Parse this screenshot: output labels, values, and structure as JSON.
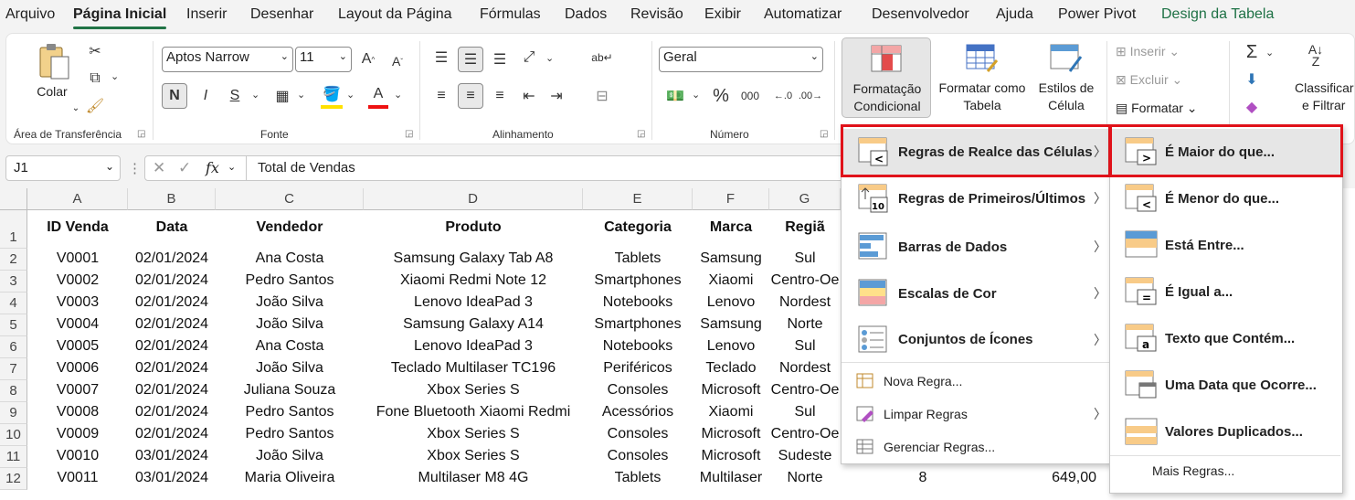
{
  "tabs": [
    "Arquivo",
    "Página Inicial",
    "Inserir",
    "Desenhar",
    "Layout da Página",
    "Fórmulas",
    "Dados",
    "Revisão",
    "Exibir",
    "Automatizar",
    "Desenvolvedor",
    "Ajuda",
    "Power Pivot",
    "Design da Tabela"
  ],
  "ribbon": {
    "clipboard": {
      "paste": "Colar",
      "group": "Área de Transferência"
    },
    "font": {
      "name": "Aptos Narrow",
      "size": "11",
      "group": "Fonte",
      "bold": "N",
      "italic": "I",
      "underline": "S"
    },
    "alignment": {
      "group": "Alinhamento"
    },
    "number": {
      "format": "Geral",
      "group": "Número",
      "percent": "%",
      "thousands": "000"
    },
    "styles": {
      "conditional": "Formatação Condicional",
      "conditional_l1": "Formatação",
      "conditional_l2": "Condicional",
      "table_l1": "Formatar como",
      "table_l2": "Tabela",
      "cell_l1": "Estilos de",
      "cell_l2": "Célula"
    },
    "cells": {
      "insert": "Inserir",
      "delete": "Excluir",
      "format": "Formatar"
    },
    "editing": {
      "sort_l1": "Classificar",
      "sort_l2": "e Filtrar"
    }
  },
  "formula_bar": {
    "cell_ref": "J1",
    "fx": "fx",
    "content": "Total de Vendas"
  },
  "columns": [
    "A",
    "B",
    "C",
    "D",
    "E",
    "F",
    "G"
  ],
  "rows": [
    "1",
    "2",
    "3",
    "4",
    "5",
    "6",
    "7",
    "8",
    "9",
    "10",
    "11",
    "12"
  ],
  "table": {
    "headers": [
      "ID Venda",
      "Data",
      "Vendedor",
      "Produto",
      "Categoria",
      "Marca",
      "Região"
    ],
    "header_shown": [
      "ID Venda",
      "Data",
      "Vendedor",
      "Produto",
      "Categoria",
      "Marca",
      "Regiã"
    ],
    "data": [
      [
        "V0001",
        "02/01/2024",
        "Ana Costa",
        "Samsung Galaxy Tab A8",
        "Tablets",
        "Samsung",
        "Sul"
      ],
      [
        "V0002",
        "02/01/2024",
        "Pedro Santos",
        "Xiaomi Redmi Note 12",
        "Smartphones",
        "Xiaomi",
        "Centro-Oe"
      ],
      [
        "V0003",
        "02/01/2024",
        "João Silva",
        "Lenovo IdeaPad 3",
        "Notebooks",
        "Lenovo",
        "Nordest"
      ],
      [
        "V0004",
        "02/01/2024",
        "João Silva",
        "Samsung Galaxy A14",
        "Smartphones",
        "Samsung",
        "Norte"
      ],
      [
        "V0005",
        "02/01/2024",
        "Ana Costa",
        "Lenovo IdeaPad 3",
        "Notebooks",
        "Lenovo",
        "Sul"
      ],
      [
        "V0006",
        "02/01/2024",
        "João Silva",
        "Teclado Multilaser TC196",
        "Periféricos",
        "Teclado",
        "Nordest"
      ],
      [
        "V0007",
        "02/01/2024",
        "Juliana Souza",
        "Xbox Series S",
        "Consoles",
        "Microsoft",
        "Centro-Oe"
      ],
      [
        "V0008",
        "02/01/2024",
        "Pedro Santos",
        "Fone Bluetooth Xiaomi Redmi",
        "Acessórios",
        "Xiaomi",
        "Sul"
      ],
      [
        "V0009",
        "02/01/2024",
        "Pedro Santos",
        "Xbox Series S",
        "Consoles",
        "Microsoft",
        "Centro-Oe"
      ],
      [
        "V0010",
        "03/01/2024",
        "João Silva",
        "Xbox Series S",
        "Consoles",
        "Microsoft",
        "Sudeste"
      ],
      [
        "V0011",
        "03/01/2024",
        "Maria Oliveira",
        "Multilaser M8 4G",
        "Tablets",
        "Multilaser",
        "Norte"
      ]
    ],
    "row12_extra": {
      "qty": "8",
      "value": "649,00"
    }
  },
  "menu": {
    "items": [
      {
        "label": "Regras de Realce das Células",
        "icon": "highlight-cells-rules-icon"
      },
      {
        "label": "Regras de Primeiros/Últimos",
        "icon": "top-bottom-rules-icon"
      },
      {
        "label": "Barras de Dados",
        "icon": "data-bars-icon"
      },
      {
        "label": "Escalas de Cor",
        "icon": "color-scales-icon"
      },
      {
        "label": "Conjuntos de Ícones",
        "icon": "icon-sets-icon"
      }
    ],
    "small_items": [
      {
        "label": "Nova Regra...",
        "icon": "new-rule-icon"
      },
      {
        "label": "Limpar Regras",
        "icon": "clear-rules-icon"
      },
      {
        "label": "Gerenciar Regras...",
        "icon": "manage-rules-icon"
      }
    ]
  },
  "submenu": {
    "items": [
      {
        "label": "É Maior do que...",
        "icon": "greater-than-icon"
      },
      {
        "label": "É Menor do que...",
        "icon": "less-than-icon"
      },
      {
        "label": "Está Entre...",
        "icon": "between-icon"
      },
      {
        "label": "É Igual a...",
        "icon": "equal-to-icon"
      },
      {
        "label": "Texto que Contém...",
        "icon": "text-contains-icon"
      },
      {
        "label": "Uma Data que Ocorre...",
        "icon": "date-occurring-icon"
      },
      {
        "label": "Valores Duplicados...",
        "icon": "duplicate-values-icon"
      }
    ],
    "more": "Mais Regras..."
  },
  "colors": {
    "accent_green": "#217346",
    "highlight_red": "#e0121a",
    "contextual_tab": "#1e7145"
  }
}
